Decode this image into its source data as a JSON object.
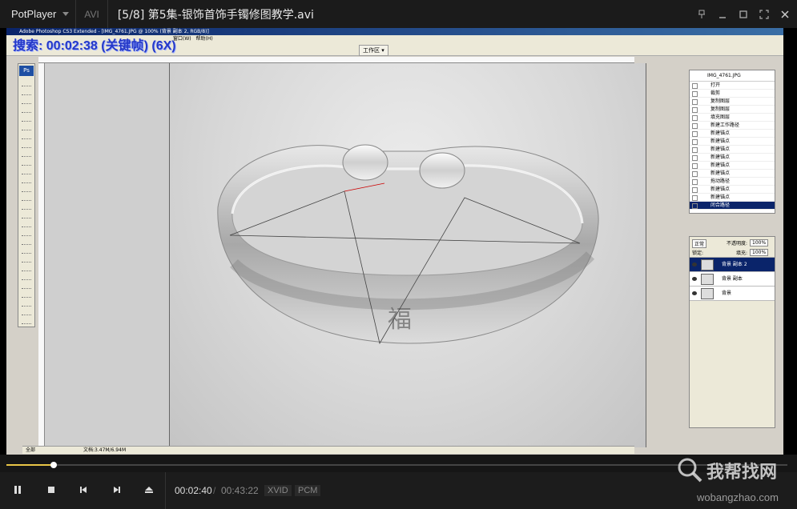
{
  "player": {
    "app_name": "PotPlayer",
    "format": "AVI",
    "file_title": "[5/8] 第5集-银饰首饰手镯修图教学.avi"
  },
  "photoshop": {
    "window_title": "Adobe Photoshop CS3 Extended - [IMG_4761.JPG @ 100% (背景 副本 2, RGB/8)]",
    "menu": [
      "窗口(W)",
      "帮助(H)"
    ],
    "workspace_label": "工作区 ▾",
    "overlay_text": "搜索: 00:02:38 (关键帧) (6X)",
    "status_zoom": "全部",
    "status_doc": "文档:3.47M/6.94M",
    "history": {
      "snapshot": "IMG_4761.JPG",
      "items": [
        "打开",
        "裁剪",
        "复制图层",
        "复制图层",
        "填充图层",
        "新建工作路径",
        "新建锚点",
        "新建锚点",
        "新建锚点",
        "新建锚点",
        "新建锚点",
        "新建锚点",
        "拖动路径",
        "新建锚点",
        "新建锚点",
        "闭合路径"
      ]
    },
    "layers": {
      "blend_mode": "正常",
      "opacity_label": "不透明度:",
      "opacity_value": "100%",
      "lock_label": "锁定:",
      "fill_label": "填充:",
      "fill_value": "100%",
      "rows": [
        "背景 副本 2",
        "背景 副本",
        "背景"
      ]
    }
  },
  "playback": {
    "progress": 0.061,
    "time_current": "00:02:40",
    "time_separator": "/",
    "time_total": "00:43:22",
    "video_codec": "XVID",
    "audio_codec": "PCM"
  },
  "watermark": {
    "brand": "我帮找网",
    "url": "wobangzhao.com"
  },
  "colors": {
    "seek_fill": "#e8c547",
    "overlay_text": "#2438c8"
  }
}
